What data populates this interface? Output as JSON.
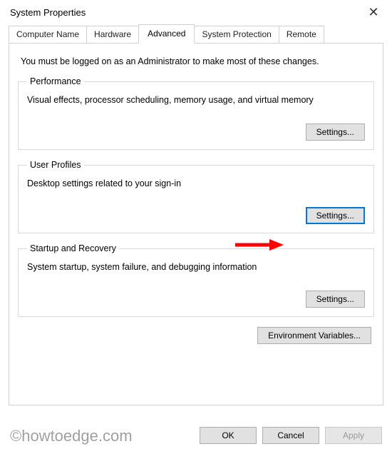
{
  "window": {
    "title": "System Properties",
    "close": "✕"
  },
  "tabs": {
    "computer_name": "Computer Name",
    "hardware": "Hardware",
    "advanced": "Advanced",
    "system_protection": "System Protection",
    "remote": "Remote"
  },
  "intro": "You must be logged on as an Administrator to make most of these changes.",
  "performance": {
    "legend": "Performance",
    "desc": "Visual effects, processor scheduling, memory usage, and virtual memory",
    "button": "Settings..."
  },
  "user_profiles": {
    "legend": "User Profiles",
    "desc": "Desktop settings related to your sign-in",
    "button": "Settings..."
  },
  "startup": {
    "legend": "Startup and Recovery",
    "desc": "System startup, system failure, and debugging information",
    "button": "Settings..."
  },
  "env_button": "Environment Variables...",
  "buttons": {
    "ok": "OK",
    "cancel": "Cancel",
    "apply": "Apply"
  },
  "watermark": "©howtoedge.com"
}
